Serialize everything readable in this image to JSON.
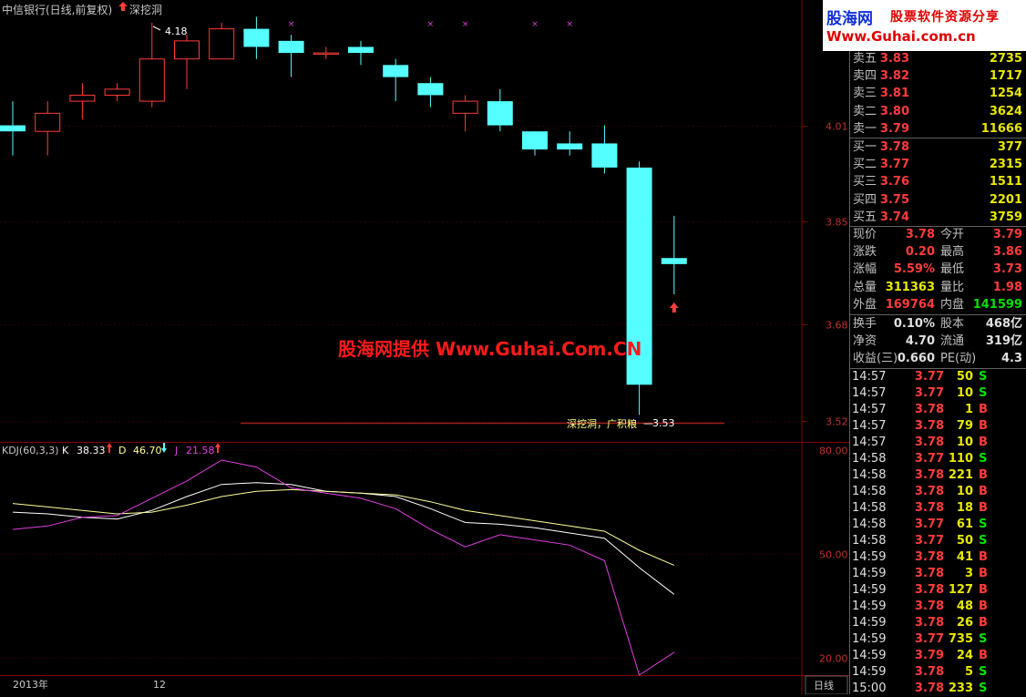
{
  "header": {
    "stock_title": "中信银行(日线,前复权)",
    "signal_label": "深挖洞"
  },
  "logo": {
    "line1_brand": "股海网",
    "line1_slogan": "股票软件资源分享",
    "line2": "Www.Guhai.com.cn"
  },
  "watermark": "股海网提供 Www.Guhai.Com.CN",
  "colors": {
    "up": "#ff3c3c",
    "down": "#55ffff",
    "k": "#ffffff",
    "d": "#ffff99",
    "j": "#e040e0"
  },
  "chart_data": [
    {
      "type": "candlestick",
      "title": "中信银行(日线,前复权)",
      "price_axis": {
        "ticks": [
          "4.01",
          "3.85",
          "3.68",
          "3.52"
        ],
        "range": [
          3.52,
          4.18
        ]
      },
      "candles": [
        {
          "open": 4.01,
          "close": 4.0,
          "high": 4.05,
          "low": 3.96
        },
        {
          "open": 4.0,
          "close": 4.03,
          "high": 4.05,
          "low": 3.96
        },
        {
          "open": 4.05,
          "close": 4.06,
          "high": 4.08,
          "low": 4.02
        },
        {
          "open": 4.06,
          "close": 4.07,
          "high": 4.08,
          "low": 4.05
        },
        {
          "open": 4.05,
          "close": 4.12,
          "high": 4.18,
          "low": 4.04
        },
        {
          "open": 4.12,
          "close": 4.15,
          "high": 4.16,
          "low": 4.07
        },
        {
          "open": 4.12,
          "close": 4.17,
          "high": 4.18,
          "low": 4.12
        },
        {
          "open": 4.17,
          "close": 4.14,
          "high": 4.19,
          "low": 4.12
        },
        {
          "open": 4.15,
          "close": 4.13,
          "high": 4.16,
          "low": 4.09
        },
        {
          "open": 4.13,
          "close": 4.13,
          "high": 4.14,
          "low": 4.12
        },
        {
          "open": 4.14,
          "close": 4.13,
          "high": 4.15,
          "low": 4.11
        },
        {
          "open": 4.11,
          "close": 4.09,
          "high": 4.12,
          "low": 4.05
        },
        {
          "open": 4.08,
          "close": 4.06,
          "high": 4.09,
          "low": 4.04
        },
        {
          "open": 4.03,
          "close": 4.05,
          "high": 4.06,
          "low": 4.0
        },
        {
          "open": 4.05,
          "close": 4.01,
          "high": 4.07,
          "low": 4.0
        },
        {
          "open": 4.0,
          "close": 3.97,
          "high": 4.0,
          "low": 3.96
        },
        {
          "open": 3.98,
          "close": 3.97,
          "high": 4.0,
          "low": 3.96
        },
        {
          "open": 3.98,
          "close": 3.94,
          "high": 4.01,
          "low": 3.93
        },
        {
          "open": 3.94,
          "close": 3.58,
          "high": 3.95,
          "low": 3.53
        },
        {
          "open": 3.79,
          "close": 3.78,
          "high": 3.86,
          "low": 3.73
        }
      ],
      "annotations": {
        "high_label": "4.18",
        "signal_text": "深挖洞，广积粮",
        "low_label": "3.53"
      }
    },
    {
      "type": "line",
      "title": "KDJ(60,3,3)",
      "series": [
        {
          "name": "K",
          "current": "38.33",
          "values": [
            62.0,
            61.5,
            60.5,
            60.0,
            62.5,
            66.5,
            70.0,
            70.5,
            70.0,
            68.0,
            67.5,
            66.5,
            63.0,
            59.0,
            58.5,
            57.5,
            56.0,
            54.5,
            46.0,
            38.3
          ]
        },
        {
          "name": "D",
          "current": "46.70",
          "values": [
            64.5,
            63.5,
            62.5,
            61.5,
            62.0,
            64.0,
            66.5,
            68.0,
            68.5,
            68.0,
            67.5,
            67.0,
            65.0,
            62.5,
            61.0,
            59.5,
            58.0,
            56.5,
            51.0,
            46.7
          ]
        },
        {
          "name": "J",
          "current": "21.58",
          "values": [
            57.0,
            58.0,
            60.5,
            61.0,
            66.0,
            71.0,
            77.0,
            75.0,
            69.0,
            67.5,
            66.0,
            63.0,
            57.0,
            52.0,
            55.5,
            54.0,
            52.5,
            48.0,
            15.0,
            21.6
          ]
        }
      ],
      "y_axis": {
        "ticks": [
          "80.00",
          "50.00",
          "20.00"
        ],
        "range": [
          15,
          82
        ]
      }
    }
  ],
  "date_axis": {
    "labels": [
      "2013年",
      "12"
    ]
  },
  "period_label": "日线",
  "quotes": {
    "asks": [
      {
        "label": "卖五",
        "price": "3.83",
        "vol": "2735"
      },
      {
        "label": "卖四",
        "price": "3.82",
        "vol": "1717"
      },
      {
        "label": "卖三",
        "price": "3.81",
        "vol": "1254"
      },
      {
        "label": "卖二",
        "price": "3.80",
        "vol": "3624"
      },
      {
        "label": "卖一",
        "price": "3.79",
        "vol": "11666"
      }
    ],
    "bids": [
      {
        "label": "买一",
        "price": "3.78",
        "vol": "377"
      },
      {
        "label": "买二",
        "price": "3.77",
        "vol": "2315"
      },
      {
        "label": "买三",
        "price": "3.76",
        "vol": "1511"
      },
      {
        "label": "买四",
        "price": "3.75",
        "vol": "2201"
      },
      {
        "label": "买五",
        "price": "3.74",
        "vol": "3759"
      }
    ]
  },
  "info": {
    "block1": [
      {
        "l": "现价",
        "lv": "3.78",
        "lc": "red",
        "r": "今开",
        "rv": "3.79",
        "rc": "red"
      },
      {
        "l": "涨跌",
        "lv": "0.20",
        "lc": "red",
        "r": "最高",
        "rv": "3.86",
        "rc": "red"
      },
      {
        "l": "涨幅",
        "lv": "5.59%",
        "lc": "red",
        "r": "最低",
        "rv": "3.73",
        "rc": "red"
      },
      {
        "l": "总量",
        "lv": "311363",
        "lc": "ylw",
        "r": "量比",
        "rv": "1.98",
        "rc": "red"
      },
      {
        "l": "外盘",
        "lv": "169764",
        "lc": "red",
        "r": "内盘",
        "rv": "141599",
        "rc": "grn"
      }
    ],
    "block2": [
      {
        "l": "换手",
        "lv": "0.10%",
        "lc": "wht",
        "r": "股本",
        "rv": "468亿",
        "rc": "wht"
      },
      {
        "l": "净资",
        "lv": "4.70",
        "lc": "wht",
        "r": "流通",
        "rv": "319亿",
        "rc": "wht"
      },
      {
        "l": "收益(三)",
        "lv": "0.660",
        "lc": "wht",
        "r": "PE(动)",
        "rv": "4.3",
        "rc": "wht"
      }
    ]
  },
  "ticks": [
    {
      "t": "14:57",
      "p": "3.77",
      "v": "50",
      "f": "S",
      "vc": "ylw"
    },
    {
      "t": "14:57",
      "p": "3.77",
      "v": "10",
      "f": "S",
      "vc": "ylw"
    },
    {
      "t": "14:57",
      "p": "3.78",
      "v": "1",
      "f": "B",
      "vc": "ylw"
    },
    {
      "t": "14:57",
      "p": "3.78",
      "v": "79",
      "f": "B",
      "vc": "ylw"
    },
    {
      "t": "14:57",
      "p": "3.78",
      "v": "10",
      "f": "B",
      "vc": "ylw"
    },
    {
      "t": "14:58",
      "p": "3.77",
      "v": "110",
      "f": "S",
      "vc": "ylw"
    },
    {
      "t": "14:58",
      "p": "3.78",
      "v": "221",
      "f": "B",
      "vc": "ylw"
    },
    {
      "t": "14:58",
      "p": "3.78",
      "v": "10",
      "f": "B",
      "vc": "ylw"
    },
    {
      "t": "14:58",
      "p": "3.78",
      "v": "18",
      "f": "B",
      "vc": "ylw"
    },
    {
      "t": "14:58",
      "p": "3.77",
      "v": "61",
      "f": "S",
      "vc": "ylw"
    },
    {
      "t": "14:58",
      "p": "3.77",
      "v": "50",
      "f": "S",
      "vc": "ylw"
    },
    {
      "t": "14:59",
      "p": "3.78",
      "v": "41",
      "f": "B",
      "vc": "ylw"
    },
    {
      "t": "14:59",
      "p": "3.78",
      "v": "3",
      "f": "B",
      "vc": "ylw"
    },
    {
      "t": "14:59",
      "p": "3.78",
      "v": "127",
      "f": "B",
      "vc": "ylw"
    },
    {
      "t": "14:59",
      "p": "3.78",
      "v": "48",
      "f": "B",
      "vc": "ylw"
    },
    {
      "t": "14:59",
      "p": "3.78",
      "v": "26",
      "f": "B",
      "vc": "ylw"
    },
    {
      "t": "14:59",
      "p": "3.77",
      "v": "735",
      "f": "S",
      "vc": "mag"
    },
    {
      "t": "14:59",
      "p": "3.79",
      "v": "24",
      "f": "B",
      "vc": "ylw"
    },
    {
      "t": "14:59",
      "p": "3.78",
      "v": "5",
      "f": "S",
      "vc": "ylw"
    },
    {
      "t": "15:00",
      "p": "3.78",
      "v": "233",
      "f": "S",
      "vc": "ylw"
    }
  ]
}
